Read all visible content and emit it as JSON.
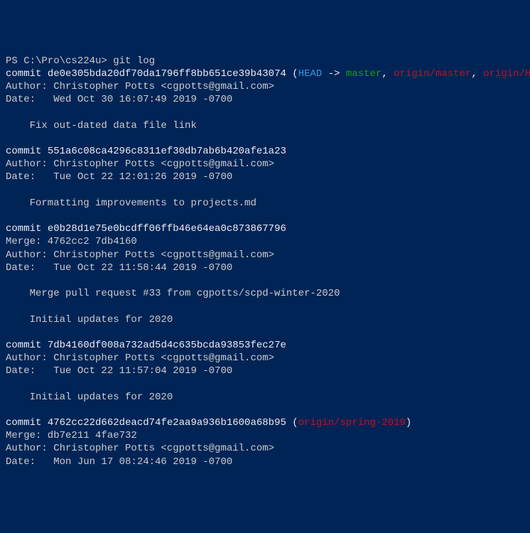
{
  "prompt": {
    "ps": "PS ",
    "path": "C:\\Pro\\cs224u>",
    "command": " git log"
  },
  "commits": [
    {
      "prefix": "commit ",
      "hash": "de0e305bda20df70da1796ff8bb651ce39b43074",
      "refs": {
        "open": " (",
        "head": "HEAD",
        "arrow": " -> ",
        "master": "master",
        "c1": ", ",
        "origin_master": "origin/master",
        "c2": ", ",
        "origin_head": "origin/HEAD",
        "close": ")"
      },
      "author": "Author: Christopher Potts <cgpotts@gmail.com>",
      "date": "Date:   Wed Oct 30 16:07:49 2019 -0700",
      "msg": "    Fix out-dated data file link"
    },
    {
      "prefix": "commit ",
      "hash": "551a6c08ca4296c8311ef30db7ab6b420afe1a23",
      "author": "Author: Christopher Potts <cgpotts@gmail.com>",
      "date": "Date:   Tue Oct 22 12:01:26 2019 -0700",
      "msg": "    Formatting improvements to projects.md"
    },
    {
      "prefix": "commit ",
      "hash": "e0b28d1e75e0bcdff06ffb46e64ea0c873867796",
      "merge": "Merge: 4762cc2 7db4160",
      "author": "Author: Christopher Potts <cgpotts@gmail.com>",
      "date": "Date:   Tue Oct 22 11:58:44 2019 -0700",
      "msg": "    Merge pull request #33 from cgpotts/scpd-winter-2020",
      "msg2": "    Initial updates for 2020"
    },
    {
      "prefix": "commit ",
      "hash": "7db4160df008a732ad5d4c635bcda93853fec27e",
      "author": "Author: Christopher Potts <cgpotts@gmail.com>",
      "date": "Date:   Tue Oct 22 11:57:04 2019 -0700",
      "msg": "    Initial updates for 2020"
    },
    {
      "prefix": "commit ",
      "hash": "4762cc22d662deacd74fe2aa9a936b1600a68b95",
      "refs": {
        "open": " (",
        "origin_spring": "origin/spring-2019",
        "close": ")"
      },
      "merge": "Merge: db7e211 4fae732",
      "author": "Author: Christopher Potts <cgpotts@gmail.com>",
      "date": "Date:   Mon Jun 17 08:24:46 2019 -0700"
    }
  ]
}
